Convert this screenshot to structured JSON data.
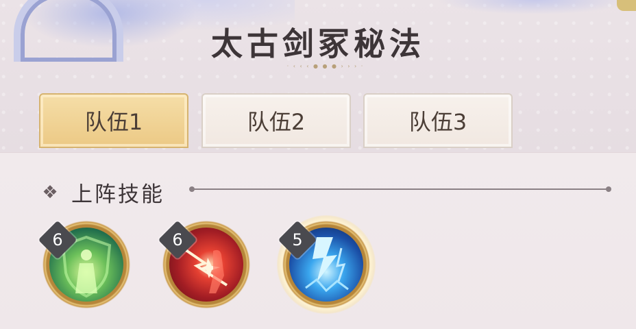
{
  "header": {
    "title": "太古剑冢秘法"
  },
  "tabs": [
    {
      "label": "队伍1",
      "active": true
    },
    {
      "label": "队伍2",
      "active": false
    },
    {
      "label": "队伍3",
      "active": false
    }
  ],
  "section": {
    "title": "上阵技能"
  },
  "skills": [
    {
      "level": "6",
      "icon": "green-shield-figure-icon",
      "color": "#4aa85a"
    },
    {
      "level": "6",
      "icon": "red-strike-figure-icon",
      "color": "#c8302c"
    },
    {
      "level": "5",
      "icon": "blue-lightning-icon",
      "color": "#2f86d8",
      "selected": true
    }
  ],
  "colors": {
    "tab_active": "#ecc985",
    "tab_inactive": "#f4ede7",
    "ring_gold": "#c99a4a",
    "badge": "#4a4a4f"
  }
}
